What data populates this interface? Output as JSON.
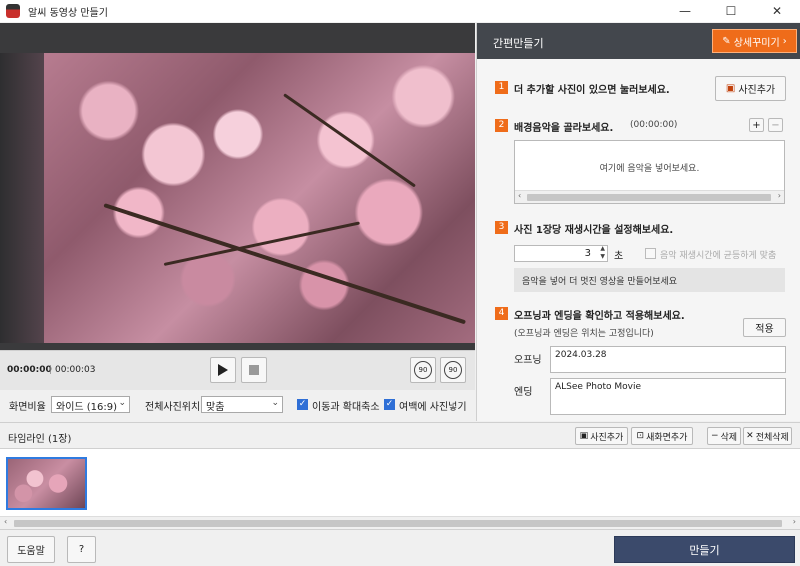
{
  "window": {
    "title": "알씨 동영상 만들기",
    "minimize": "—",
    "maximize": "☐",
    "close": "✕"
  },
  "player": {
    "current_time": "00:00:00",
    "total_time": "00:00:03",
    "separator": "|",
    "rotate_left_label": "90",
    "rotate_right_label": "90"
  },
  "options": {
    "ratio_label": "화면비율",
    "ratio_value": "와이드 (16:9)",
    "position_label": "전체사진위치",
    "position_value": "맞춤",
    "move_zoom_label": "이동과 확대축소",
    "fill_margin_label": "여백에 사진넣기"
  },
  "panel": {
    "title": "간편만들기",
    "detail_button": "상세꾸미기",
    "step1": {
      "num": "1",
      "text": "더 추가할 사진이 있으면 눌러보세요.",
      "add_photo": "사진추가"
    },
    "step2": {
      "num": "2",
      "text": "배경음악을 골라보세요.",
      "time": "(00:00:00)",
      "placeholder": "여기에 음악을 넣어보세요."
    },
    "step3": {
      "num": "3",
      "text": "사진 1장당 재생시간을 설정해보세요.",
      "seconds_value": "3",
      "unit": "초",
      "fit_music_label": "음악 재생시간에 균등하게 맞춤",
      "hint": "음악을 넣어 더 멋진 영상을 만들어보세요"
    },
    "step4": {
      "num": "4",
      "text": "오프닝과 엔딩을 확인하고 적용해보세요.",
      "sub": "(오프닝과 엔딩은 위치는 고정입니다)",
      "apply": "적용",
      "opening_label": "오프닝",
      "opening_value": "2024.03.28",
      "ending_label": "엔딩",
      "ending_value": "ALSee Photo Movie"
    }
  },
  "timeline": {
    "label": "타임라인 (1장)",
    "add_photo": "사진추가",
    "new_screen_add": "새화면추가",
    "delete": "삭제",
    "delete_all": "전체삭제"
  },
  "bottom": {
    "help": "도움말",
    "question": "?",
    "make": "만들기"
  },
  "colors": {
    "accent": "#ef6c1a",
    "panel_header": "#43474d",
    "make_button": "#3b4a6b",
    "selection": "#2f7be0"
  }
}
